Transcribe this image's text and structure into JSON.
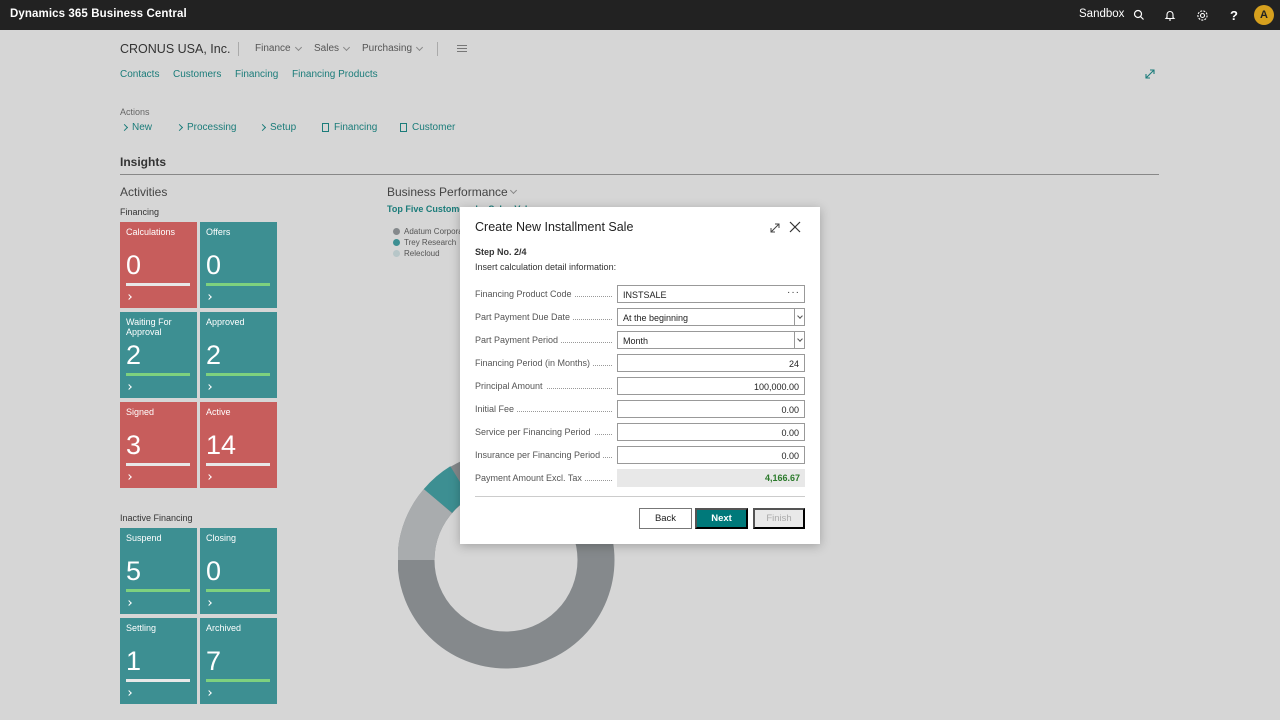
{
  "topbar": {
    "app_title": "Dynamics 365 Business Central",
    "environment": "Sandbox",
    "avatar_initial": "A"
  },
  "header": {
    "company": "CRONUS USA, Inc.",
    "menus": [
      "Finance",
      "Sales",
      "Purchasing"
    ],
    "links": [
      "Contacts",
      "Customers",
      "Financing",
      "Financing Products"
    ]
  },
  "actions": {
    "label": "Actions",
    "items": [
      "New",
      "Processing",
      "Setup",
      "Financing",
      "Customer"
    ]
  },
  "insights": {
    "title": "Insights"
  },
  "activities": {
    "title": "Activities",
    "financing_label": "Financing",
    "inactive_label": "Inactive Financing",
    "tiles": [
      {
        "label": "Calculations",
        "value": "0"
      },
      {
        "label": "Offers",
        "value": "0"
      },
      {
        "label": "Waiting For Approval",
        "value": "2"
      },
      {
        "label": "Approved",
        "value": "2"
      },
      {
        "label": "Signed",
        "value": "3"
      },
      {
        "label": "Active",
        "value": "14"
      },
      {
        "label": "Suspend",
        "value": "5"
      },
      {
        "label": "Closing",
        "value": "0"
      },
      {
        "label": "Settling",
        "value": "1"
      },
      {
        "label": "Archived",
        "value": "7"
      }
    ]
  },
  "business_performance": {
    "title": "Business Performance",
    "subtitle": "Top Five Customers by Sales Value",
    "legend": [
      "Adatum Corporation",
      "Trey Research",
      "Relecloud"
    ],
    "colors": [
      "#85898c",
      "#3d8f92",
      "#b7c6c8"
    ]
  },
  "dialog": {
    "title": "Create New Installment Sale",
    "step": "Step No. 2/4",
    "instruction": "Insert calculation detail information:",
    "fields": [
      {
        "label": "Financing Product Code",
        "value": "INSTSALE"
      },
      {
        "label": "Part Payment Due Date",
        "value": "At the beginning"
      },
      {
        "label": "Part Payment Period",
        "value": "Month"
      },
      {
        "label": "Financing Period (in Months)",
        "value": "24"
      },
      {
        "label": "Principal Amount",
        "value": "100,000.00"
      },
      {
        "label": "Initial Fee",
        "value": "0.00"
      },
      {
        "label": "Service per Financing Period",
        "value": "0.00"
      },
      {
        "label": "Insurance per Financing Period",
        "value": "0.00"
      },
      {
        "label": "Payment Amount Excl. Tax",
        "value": "4,166.67"
      }
    ],
    "buttons": {
      "back": "Back",
      "next": "Next",
      "finish": "Finish"
    }
  }
}
